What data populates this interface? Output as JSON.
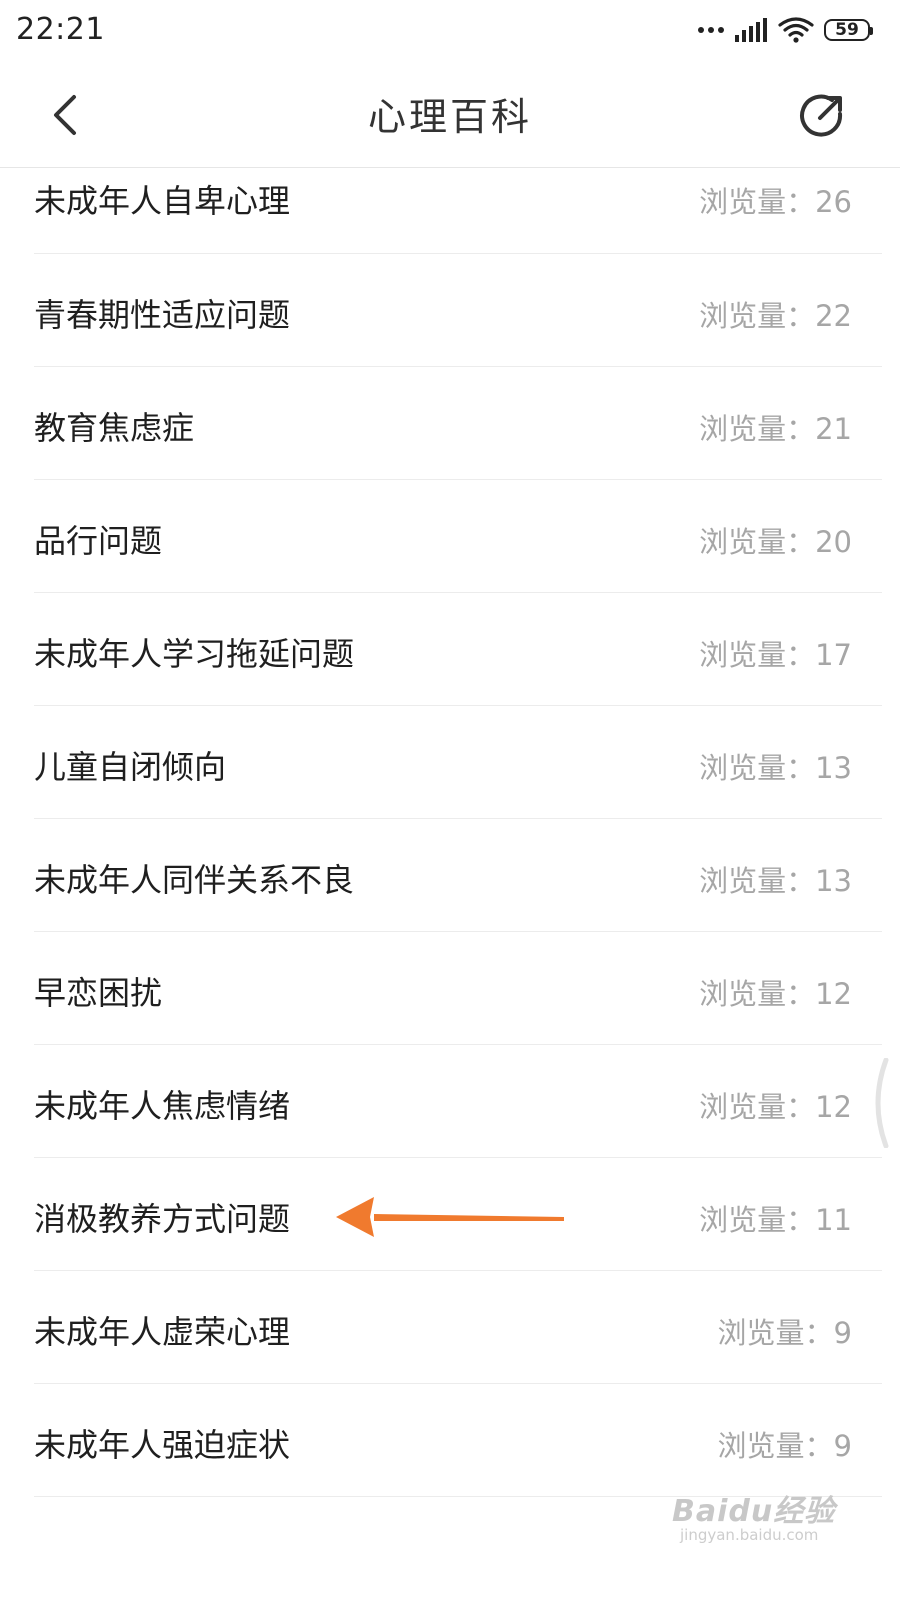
{
  "status_bar": {
    "time": "22:21",
    "battery": "59",
    "icons": [
      "more-dots-icon",
      "signal-icon",
      "wifi-icon",
      "battery-icon"
    ]
  },
  "nav": {
    "title": "心理百科",
    "back_icon": "chevron-left-icon",
    "share_icon": "share-icon"
  },
  "list": {
    "items": [
      {
        "title": "未成年人自卑心理",
        "views": "浏览量：26"
      },
      {
        "title": "青春期性适应问题",
        "views": "浏览量：22"
      },
      {
        "title": "教育焦虑症",
        "views": "浏览量：21"
      },
      {
        "title": "品行问题",
        "views": "浏览量：20"
      },
      {
        "title": "未成年人学习拖延问题",
        "views": "浏览量：17"
      },
      {
        "title": "儿童自闭倾向",
        "views": "浏览量：13"
      },
      {
        "title": "未成年人同伴关系不良",
        "views": "浏览量：13"
      },
      {
        "title": "早恋困扰",
        "views": "浏览量：12"
      },
      {
        "title": "未成年人焦虑情绪",
        "views": "浏览量：12"
      },
      {
        "title": "消极教养方式问题",
        "views": "浏览量：11"
      },
      {
        "title": "未成年人虚荣心理",
        "views": "浏览量：9"
      },
      {
        "title": "未成年人强迫症状",
        "views": "浏览量：9"
      }
    ]
  },
  "annotation": {
    "color": "#f07a2e",
    "points_to": "消极教养方式问题"
  },
  "watermark": {
    "logo": "Baidu经验",
    "site": "jingyan.baidu.com"
  }
}
